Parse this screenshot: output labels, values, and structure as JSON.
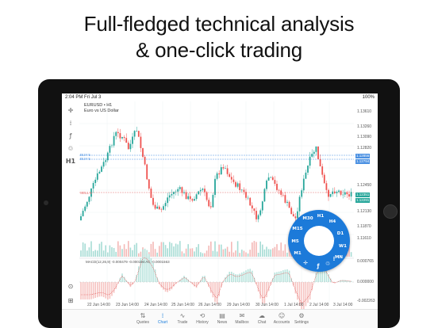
{
  "headline": [
    "Full-fledged technical analysis",
    "& one-click trading"
  ],
  "status": {
    "time": "2:04 PM",
    "date": "Fri Jul 3",
    "battery": "100%"
  },
  "symbol": {
    "line1": "EURUSD • H1",
    "line2": "Euro vs US Dollar"
  },
  "left_tools": [
    "✛",
    "⁞",
    "ƒ",
    "♲",
    "H1"
  ],
  "left_bottom": [
    "⊙",
    "⊞"
  ],
  "trade_lines": {
    "buy": "BUY 5",
    "sell": "SELL 5"
  },
  "price_tags": {
    "p1": "1.12856",
    "p2": "1.12794",
    "p3": "1.12351",
    "p4": "1.12291"
  },
  "y_labels": [
    "1.13610",
    "1.13260",
    "1.13090",
    "1.12820",
    "1.12450",
    "1.12130",
    "1.11870",
    "1.11610",
    "0.000765",
    "0.000000",
    "-0.002263"
  ],
  "x_labels": [
    "22 Jun 14:00",
    "23 Jun 14:00",
    "24 Jun 14:00",
    "25 Jun 14:00",
    "26 Jun 14:00",
    "29 Jun 14:00",
    "30 Jun 14:00",
    "1 Jul 14:00",
    "2 Jul 14:00",
    "3 Jul 14:00"
  ],
  "macd_label": "MACD(12,26,9) -0.000479 -0.000194 AC -0.0001563",
  "dial": {
    "items": [
      "M30",
      "H1",
      "H4",
      "D1",
      "W1",
      "MN",
      "M1",
      "M5",
      "M15"
    ],
    "tools": [
      "✛",
      "ƒ",
      "♲",
      "⁞"
    ]
  },
  "tabs": [
    {
      "label": "Quotes",
      "icon": "⇅"
    },
    {
      "label": "Chart",
      "icon": "⁞"
    },
    {
      "label": "Trade",
      "icon": "∿"
    },
    {
      "label": "History",
      "icon": "⟲"
    },
    {
      "label": "News",
      "icon": "▤"
    },
    {
      "label": "Mailbox",
      "icon": "✉"
    },
    {
      "label": "Chat",
      "icon": "☁"
    },
    {
      "label": "Accounts",
      "icon": "☺"
    },
    {
      "label": "Settings",
      "icon": "⚙"
    }
  ],
  "colors": {
    "bull": "#26a69a",
    "bear": "#ef5350",
    "accent": "#1c7ad9",
    "buy_line": "#4a90e2",
    "sell_line": "#e57373"
  }
}
